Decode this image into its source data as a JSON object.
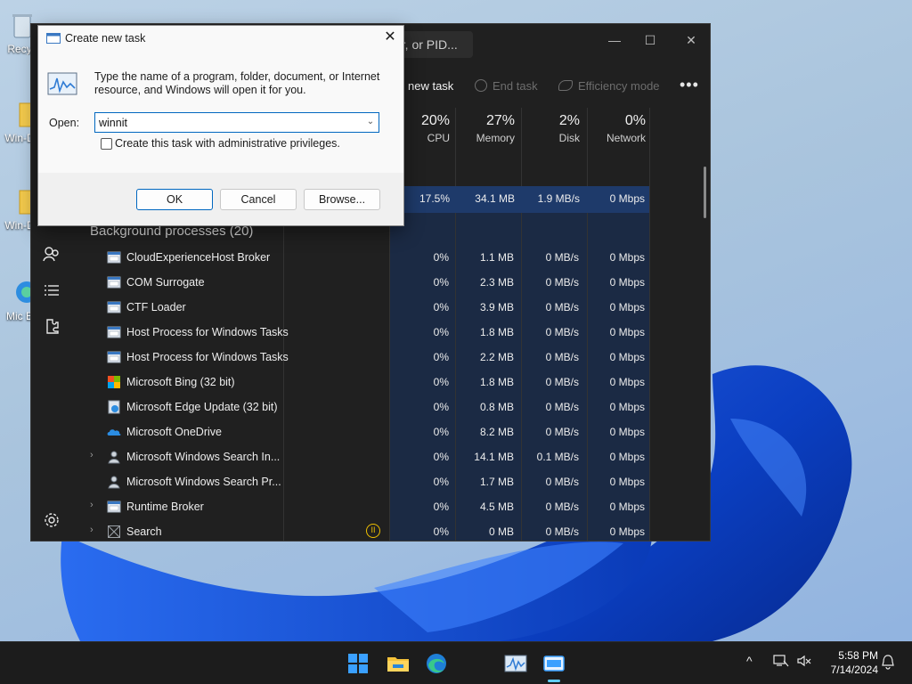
{
  "desktop": {
    "icons": [
      {
        "label": "Recy",
        "icon": "recycle-bin-icon"
      },
      {
        "label": "Win-D",
        "icon": "folder-icon"
      },
      {
        "label": "Win-D",
        "icon": "folder-icon"
      },
      {
        "label": "Mic E",
        "icon": "edge-icon"
      }
    ]
  },
  "task_manager": {
    "search_placeholder": "er, or PID...",
    "window_controls": {
      "minimize": "—",
      "maximize": "☐",
      "close": "✕"
    },
    "toolbar": {
      "new_task": "new task",
      "end_task": "End task",
      "efficiency_mode": "Efficiency mode",
      "more": "•••"
    },
    "columns": [
      {
        "pct": "20%",
        "label": "CPU"
      },
      {
        "pct": "27%",
        "label": "Memory"
      },
      {
        "pct": "2%",
        "label": "Disk"
      },
      {
        "pct": "0%",
        "label": "Network"
      }
    ],
    "running_row": {
      "cpu": "17.5%",
      "memory": "34.1 MB",
      "disk": "1.9 MB/s",
      "network": "0 Mbps"
    },
    "background_header": "Background processes (20)",
    "processes": [
      {
        "name": "CloudExperienceHost Broker",
        "icon": "app-window-icon",
        "expandable": false,
        "cpu": "0%",
        "memory": "1.1 MB",
        "disk": "0 MB/s",
        "network": "0 Mbps"
      },
      {
        "name": "COM Surrogate",
        "icon": "app-window-icon",
        "expandable": false,
        "cpu": "0%",
        "memory": "2.3 MB",
        "disk": "0 MB/s",
        "network": "0 Mbps"
      },
      {
        "name": "CTF Loader",
        "icon": "app-window-icon",
        "expandable": false,
        "cpu": "0%",
        "memory": "3.9 MB",
        "disk": "0 MB/s",
        "network": "0 Mbps"
      },
      {
        "name": "Host Process for Windows Tasks",
        "icon": "app-window-icon",
        "expandable": false,
        "cpu": "0%",
        "memory": "1.8 MB",
        "disk": "0 MB/s",
        "network": "0 Mbps"
      },
      {
        "name": "Host Process for Windows Tasks",
        "icon": "app-window-icon",
        "expandable": false,
        "cpu": "0%",
        "memory": "2.2 MB",
        "disk": "0 MB/s",
        "network": "0 Mbps"
      },
      {
        "name": "Microsoft Bing (32 bit)",
        "icon": "bing-logo-icon",
        "expandable": false,
        "cpu": "0%",
        "memory": "1.8 MB",
        "disk": "0 MB/s",
        "network": "0 Mbps"
      },
      {
        "name": "Microsoft Edge Update (32 bit)",
        "icon": "edge-update-icon",
        "expandable": false,
        "cpu": "0%",
        "memory": "0.8 MB",
        "disk": "0 MB/s",
        "network": "0 Mbps"
      },
      {
        "name": "Microsoft OneDrive",
        "icon": "onedrive-cloud-icon",
        "expandable": false,
        "cpu": "0%",
        "memory": "8.2 MB",
        "disk": "0 MB/s",
        "network": "0 Mbps"
      },
      {
        "name": "Microsoft Windows Search In...",
        "icon": "search-indexer-icon",
        "expandable": true,
        "cpu": "0%",
        "memory": "14.1 MB",
        "disk": "0.1 MB/s",
        "network": "0 Mbps"
      },
      {
        "name": "Microsoft Windows Search Pr...",
        "icon": "search-indexer-icon",
        "expandable": false,
        "cpu": "0%",
        "memory": "1.7 MB",
        "disk": "0 MB/s",
        "network": "0 Mbps"
      },
      {
        "name": "Runtime Broker",
        "icon": "app-window-icon",
        "expandable": true,
        "cpu": "0%",
        "memory": "4.5 MB",
        "disk": "0 MB/s",
        "network": "0 Mbps"
      },
      {
        "name": "Search",
        "icon": "search-app-icon",
        "expandable": true,
        "cpu": "0%",
        "memory": "0 MB",
        "disk": "0 MB/s",
        "network": "0 Mbps",
        "status": "paused"
      }
    ],
    "nav_icons": [
      "users-icon",
      "details-list-icon",
      "services-icon",
      "settings-gear-icon"
    ]
  },
  "dialog": {
    "title": "Create new task",
    "close": "✕",
    "description": "Type the name of a program, folder, document, or Internet resource, and Windows will open it for you.",
    "open_label": "Open:",
    "open_value": "winnit",
    "admin_checkbox_label": "Create this task with administrative privileges.",
    "admin_checked": false,
    "ok": "OK",
    "cancel": "Cancel",
    "browse": "Browse..."
  },
  "taskbar": {
    "apps": [
      "windows-start-icon",
      "file-explorer-icon",
      "edge-icon",
      "task-manager-icon",
      "run-dialog-icon"
    ],
    "tray_chevron": "^",
    "time": "5:58 PM",
    "date": "7/14/2024"
  },
  "colors": {
    "accent": "#0067c0",
    "tm_background": "#202020",
    "heat_cell": "#1b2a44",
    "highlight_row": "#1e3a6a",
    "paused_status": "#f0c000"
  }
}
